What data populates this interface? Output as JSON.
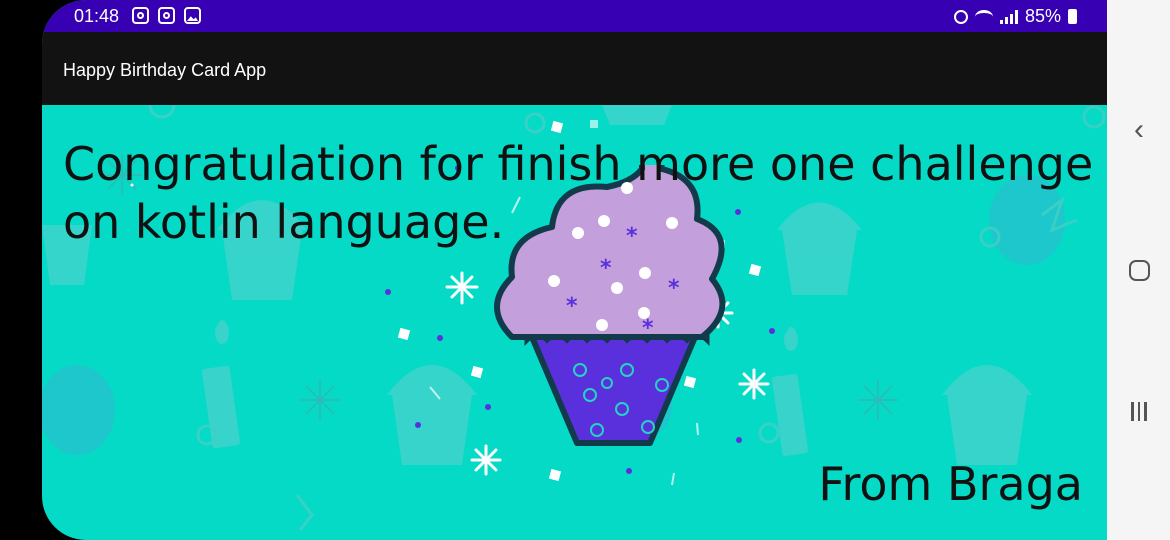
{
  "status_bar": {
    "time": "01:48",
    "battery": "85%"
  },
  "app_bar": {
    "title": "Happy Birthday Card App"
  },
  "card": {
    "message": "Congratulation for finish more one challenge on kotlin language.",
    "signature": "From Braga"
  },
  "nav_bar": {
    "back_icon": "chevron-left-icon",
    "home_icon": "home-icon",
    "recents_icon": "recents-icon"
  },
  "colors": {
    "status_bar": "#3700b3",
    "app_bar": "#121212",
    "background": "#05dac6",
    "frosting": "#c3a0dc",
    "cup": "#5a30dc"
  }
}
